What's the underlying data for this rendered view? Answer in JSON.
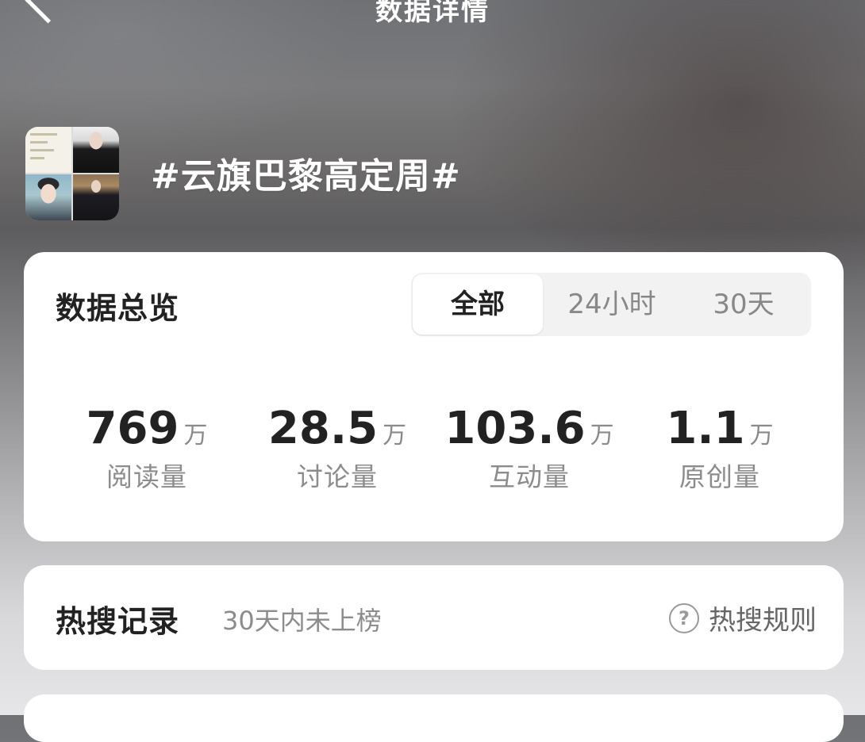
{
  "nav": {
    "title": "数据详情"
  },
  "topic": {
    "title": "#云旗巴黎高定周#",
    "thumbnail_icon": "topic-collage-thumbnail"
  },
  "overview": {
    "heading": "数据总览",
    "tabs": [
      {
        "label": "全部",
        "active": true
      },
      {
        "label": "24小时",
        "active": false
      },
      {
        "label": "30天",
        "active": false
      }
    ],
    "stats": [
      {
        "value": "769",
        "unit": "万",
        "label": "阅读量"
      },
      {
        "value": "28.5",
        "unit": "万",
        "label": "讨论量"
      },
      {
        "value": "103.6",
        "unit": "万",
        "label": "互动量"
      },
      {
        "value": "1.1",
        "unit": "万",
        "label": "原创量"
      }
    ]
  },
  "hot_search": {
    "heading": "热搜记录",
    "status": "30天内未上榜",
    "rules_label": "热搜规则",
    "rules_icon": "question-circle-icon"
  }
}
